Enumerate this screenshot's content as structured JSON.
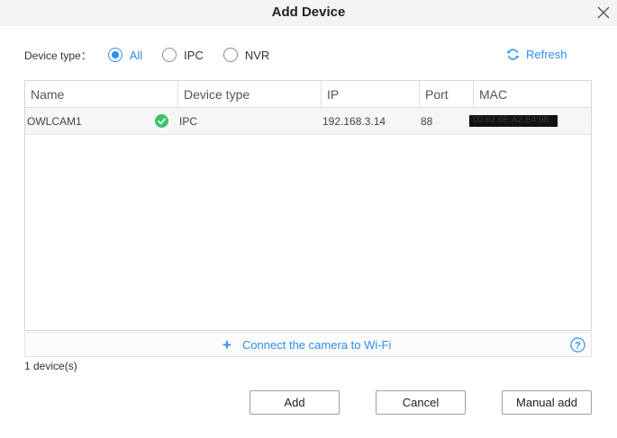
{
  "dialog": {
    "title": "Add Device"
  },
  "filter": {
    "label": "Device type：",
    "options": [
      "All",
      "IPC",
      "NVR"
    ],
    "selected": "All"
  },
  "refresh_label": "Refresh",
  "table": {
    "columns": [
      "Name",
      "Device type",
      "IP",
      "Port",
      "MAC"
    ],
    "rows": [
      {
        "name": "OWLCAM1",
        "device_type": "IPC",
        "ip": "192.168.3.14",
        "port": "88",
        "mac": "00:62:6E:A2:E4:98",
        "status_icon": "check-circle-icon"
      }
    ]
  },
  "wifi_link": "Connect the camera to Wi-Fi",
  "device_count": "1 device(s)",
  "buttons": {
    "add": "Add",
    "cancel": "Cancel",
    "manual_add": "Manual add"
  },
  "colors": {
    "accent": "#2f8ef0",
    "success": "#3cc46b",
    "selected_row": "#f6f6f6"
  }
}
